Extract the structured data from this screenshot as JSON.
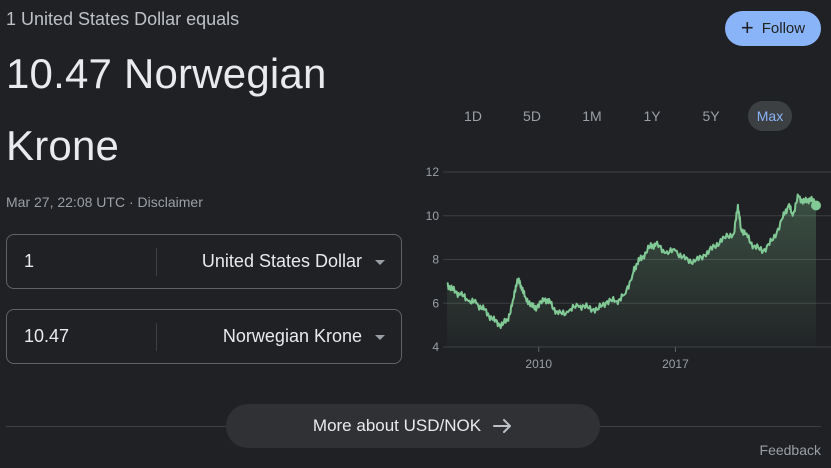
{
  "header": {
    "subtitle": "1 United States Dollar equals",
    "rate_line1": "10.47 Norwegian",
    "rate_line2": "Krone",
    "timestamp": "Mar 27, 22:08 UTC",
    "separator": "·",
    "disclaimer": "Disclaimer",
    "follow_label": "Follow",
    "follow_icon": "plus-icon"
  },
  "converter": {
    "from": {
      "amount": "1",
      "currency": "United States Dollar"
    },
    "to": {
      "amount": "10.47",
      "currency": "Norwegian Krone"
    }
  },
  "ranges": {
    "tabs": [
      "1D",
      "5D",
      "1M",
      "1Y",
      "5Y",
      "Max"
    ],
    "active": "Max"
  },
  "chart_data": {
    "type": "area",
    "y_ticks": [
      "12",
      "10",
      "8",
      "6",
      "4"
    ],
    "ylim": [
      4,
      12
    ],
    "x_ticks": [
      {
        "label": "2010",
        "x": 2010
      },
      {
        "label": "2017",
        "x": 2017
      }
    ],
    "xlim": [
      2005.3,
      2024.25
    ],
    "line_color": "#81c995",
    "grid": true,
    "series": [
      {
        "x": [
          2005.3,
          2005.6,
          2006.0,
          2006.4,
          2006.8,
          2007.2,
          2007.6,
          2008.0,
          2008.4,
          2008.7,
          2008.9,
          2009.1,
          2009.3,
          2009.6,
          2009.9,
          2010.3,
          2010.6,
          2011.0,
          2011.5,
          2012.0,
          2012.5,
          2013.0,
          2013.5,
          2014.0,
          2014.4,
          2014.8,
          2015.0,
          2015.3,
          2015.7,
          2016.0,
          2016.5,
          2017.0,
          2017.5,
          2018.0,
          2018.5,
          2019.0,
          2019.5,
          2020.0,
          2020.2,
          2020.35,
          2020.6,
          2021.0,
          2021.5,
          2022.0,
          2022.5,
          2022.8,
          2023.0,
          2023.3,
          2023.6,
          2023.9,
          2024.2
        ],
        "y": [
          6.9,
          6.6,
          6.4,
          6.1,
          6.0,
          5.7,
          5.3,
          5.0,
          5.2,
          6.2,
          7.1,
          6.8,
          6.3,
          5.9,
          5.8,
          6.2,
          6.0,
          5.5,
          5.6,
          5.9,
          5.8,
          5.7,
          6.1,
          6.1,
          6.4,
          7.3,
          7.8,
          8.1,
          8.6,
          8.7,
          8.3,
          8.4,
          8.0,
          7.9,
          8.2,
          8.6,
          9.0,
          9.2,
          10.5,
          9.4,
          9.2,
          8.6,
          8.4,
          8.9,
          9.9,
          10.5,
          10.0,
          10.9,
          10.6,
          10.8,
          10.47
        ]
      }
    ]
  },
  "footer": {
    "more_label": "More about USD/NOK",
    "more_icon": "arrow-right-icon",
    "feedback": "Feedback"
  }
}
